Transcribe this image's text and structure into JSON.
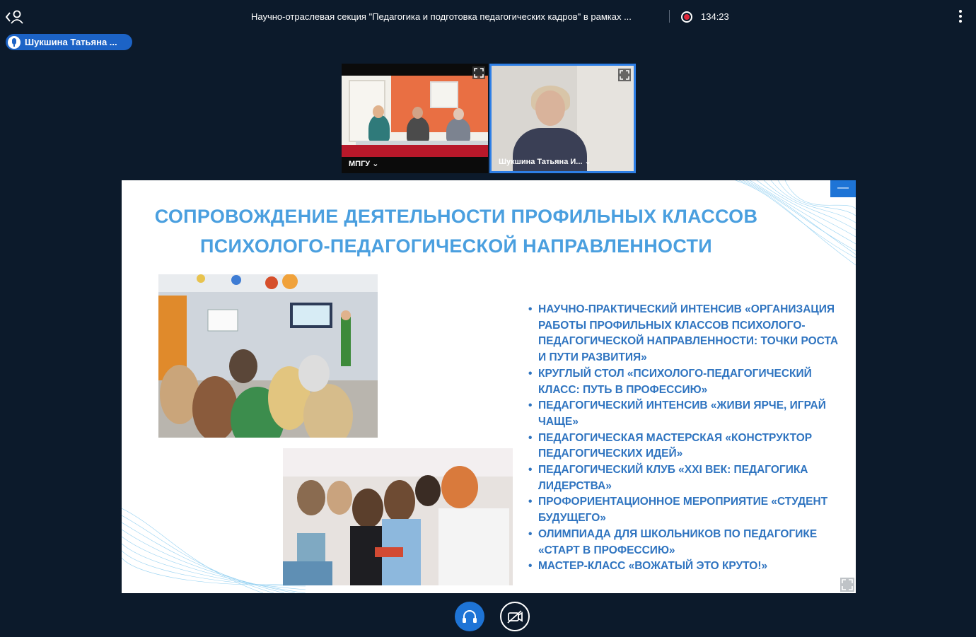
{
  "header": {
    "title": "Научно-отраслевая секция \"Педагогика и подготовка педагогических кадров\" в рамках ...",
    "timer": "134:23",
    "icons": [
      "back-user-icon",
      "record-icon",
      "more-vertical-icon"
    ]
  },
  "active_speaker": {
    "name": "Шукшина Татьяна ..."
  },
  "participants": [
    {
      "label": "МПГУ",
      "has_dropdown": true
    },
    {
      "label": "Шукшина Татьяна И...",
      "has_dropdown": true
    }
  ],
  "slide": {
    "title_line1": "СОПРОВОЖДЕНИЕ ДЕЯТЕЛЬНОСТИ ПРОФИЛЬНЫХ КЛАССОВ",
    "title_line2": "ПСИХОЛОГО-ПЕДАГОГИЧЕСКОЙ НАПРАВЛЕННОСТИ",
    "minimize_label": "—",
    "bullets": [
      "Научно-практический интенсив «Организация работы профильных классов психолого-педагогической направленности: точки роста и пути развития»",
      "Круглый стол «Психолого-педагогический класс: путь в профессию»",
      " Педагогический интенсив «Живи ярче, играй чаще»",
      "Педагогическая мастерская «Конструктор педагогических идей»",
      "Педагогический клуб «XXI век: педагогика лидерства»",
      " Профориентационное мероприятие «Студент будущего»",
      "Олимпиада для школьников по педагогике «Старт в профессию»",
      "Мастер-класс «Вожатый это круто!»"
    ]
  },
  "controls": {
    "audio_icon": "headphones-icon",
    "video_icon": "camera-off-icon",
    "colors": {
      "accent": "#1e74d6",
      "background": "#0c1a2b",
      "slide_text": "#2f74c0",
      "slide_title": "#4a9fdf"
    }
  }
}
